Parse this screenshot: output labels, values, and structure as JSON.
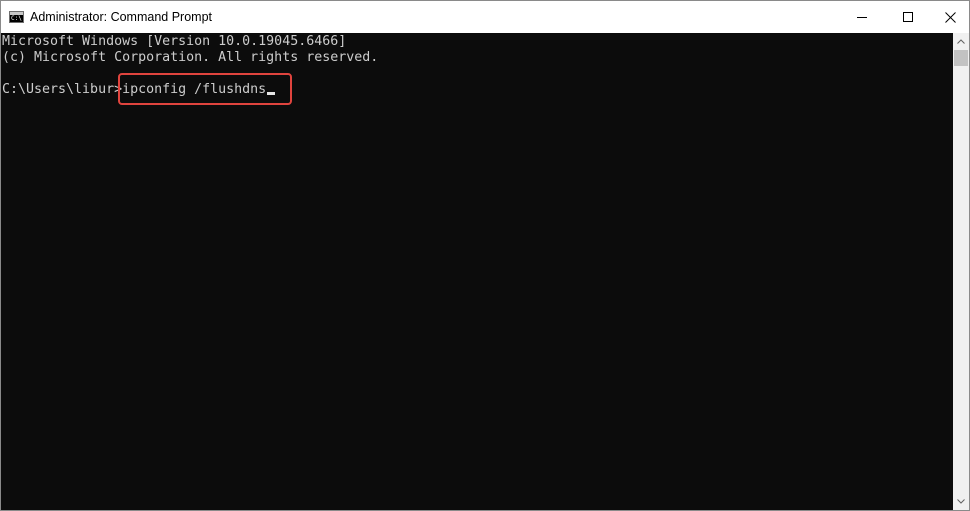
{
  "window": {
    "title": "Administrator: Command Prompt",
    "icon": "cmd-icon",
    "icon_glyph": "C:\\",
    "controls": {
      "minimize_icon": "minimize-icon",
      "maximize_icon": "maximize-icon",
      "close_icon": "close-icon"
    }
  },
  "console": {
    "lines": [
      "Microsoft Windows [Version 10.0.19045.6466]",
      "(c) Microsoft Corporation. All rights reserved."
    ],
    "prompt": "C:\\Users\\libur>",
    "command": "ipconfig /flushdns"
  },
  "colors": {
    "console_bg": "#0c0c0c",
    "console_text": "#cccccc",
    "highlight_border": "#e0443e",
    "titlebar_bg": "#ffffff"
  }
}
